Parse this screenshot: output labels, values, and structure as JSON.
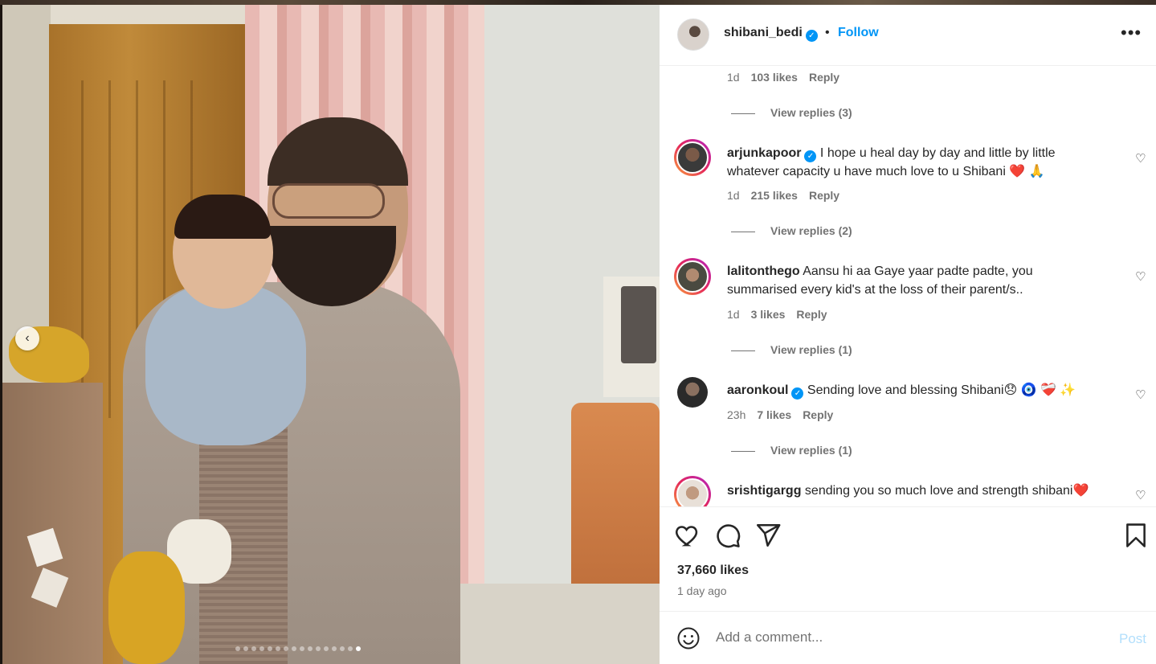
{
  "post": {
    "username": "shibani_bedi",
    "separator": "•",
    "follow_label": "Follow",
    "more_label": "•••"
  },
  "carousel": {
    "dot_count": 16,
    "active_index": 15,
    "prev_arrow": "‹"
  },
  "comments": [
    {
      "meta_time": "1d",
      "meta_likes": "103 likes",
      "reply_label": "Reply",
      "view_replies": "View replies (3)"
    },
    {
      "user": "arjunkapoor",
      "verified": true,
      "text": "I hope u heal day by day and little by little whatever capacity u have much love to u Shibani ❤️ 🙏",
      "time": "1d",
      "likes": "215 likes",
      "reply_label": "Reply",
      "view_replies": "View replies (2)"
    },
    {
      "user": "lalitonthego",
      "verified": false,
      "text": "Aansu hi aa Gaye yaar padte padte, you summarised every kid's at the loss of their parent/s..",
      "time": "1d",
      "likes": "3 likes",
      "reply_label": "Reply",
      "view_replies": "View replies (1)"
    },
    {
      "user": "aaronkoul",
      "verified": true,
      "text": "Sending love and blessing Shibani😞 🧿 ❤️‍🩹 ✨",
      "time": "23h",
      "likes": "7 likes",
      "reply_label": "Reply",
      "view_replies": "View replies (1)"
    },
    {
      "user": "srishtigargg",
      "verified": false,
      "text": "sending you so much love and strength shibani❤️"
    }
  ],
  "actions": {
    "like_icon": "heart-icon",
    "comment_icon": "comment-icon",
    "share_icon": "share-icon",
    "save_icon": "bookmark-icon"
  },
  "stats": {
    "likes": "37,660 likes",
    "posted": "1 day ago"
  },
  "add_comment": {
    "placeholder": "Add a comment...",
    "post_label": "Post"
  },
  "colors": {
    "accent": "#0095f6",
    "muted": "#737373",
    "post_disabled": "#b2dffc"
  }
}
